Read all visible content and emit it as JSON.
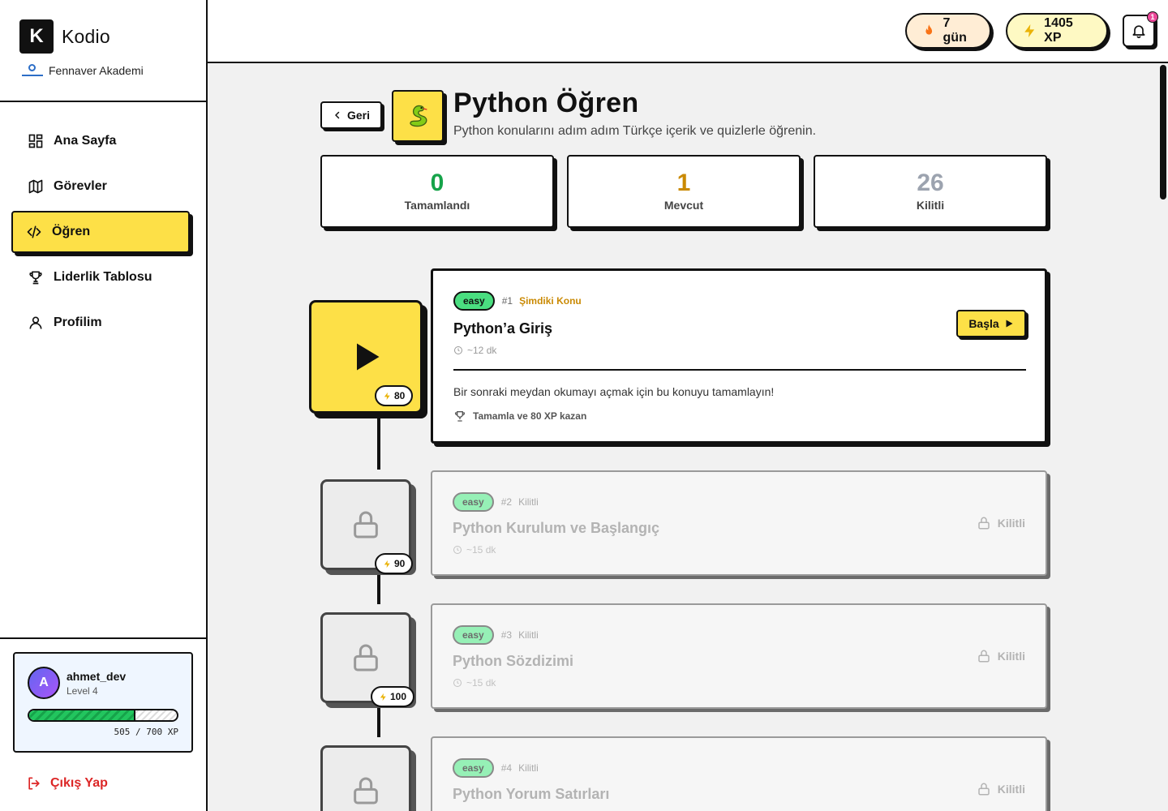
{
  "brand": {
    "logo_letter": "K",
    "name": "Kodio",
    "org": "Fennaver Akademi"
  },
  "nav": [
    {
      "label": "Ana Sayfa",
      "icon": "dashboard-icon",
      "active": false
    },
    {
      "label": "Görevler",
      "icon": "map-icon",
      "active": false
    },
    {
      "label": "Öğren",
      "icon": "code-icon",
      "active": true
    },
    {
      "label": "Liderlik Tablosu",
      "icon": "trophy-icon",
      "active": false
    },
    {
      "label": "Profilim",
      "icon": "user-icon",
      "active": false
    }
  ],
  "user": {
    "avatar_letter": "A",
    "name": "ahmet_dev",
    "level": "Level 4",
    "xp_current": 505,
    "xp_max": 700,
    "xp_text": "505 / 700 XP"
  },
  "logout_label": "Çıkış Yap",
  "topbar": {
    "streak": "7 gün",
    "xp": "1405 XP",
    "notification_count": "1"
  },
  "course": {
    "back_label": "Geri",
    "title": "Python Öğren",
    "subtitle": "Python konularını adım adım Türkçe içerik ve quizlerle öğrenin."
  },
  "stats": [
    {
      "value": "0",
      "label": "Tamamlandı"
    },
    {
      "value": "1",
      "label": "Mevcut"
    },
    {
      "value": "26",
      "label": "Kilitli"
    }
  ],
  "topics": [
    {
      "difficulty": "easy",
      "number": "#1",
      "status": "Şimdiki Konu",
      "title": "Python’a Giriş",
      "time": "~12 dk",
      "xp": "80",
      "start_label": "Başla",
      "description": "Bir sonraki meydan okumayı açmak için bu konuyu tamamlayın!",
      "reward": "Tamamla ve 80 XP kazan"
    },
    {
      "difficulty": "easy",
      "number": "#2",
      "status": "Kilitli",
      "title": "Python Kurulum ve Başlangıç",
      "time": "~15 dk",
      "xp": "90",
      "lock_label": "Kilitli"
    },
    {
      "difficulty": "easy",
      "number": "#3",
      "status": "Kilitli",
      "title": "Python Sözdizimi",
      "time": "~15 dk",
      "xp": "100",
      "lock_label": "Kilitli"
    },
    {
      "difficulty": "easy",
      "number": "#4",
      "status": "Kilitli",
      "title": "Python Yorum Satırları",
      "lock_label": "Kilitli"
    }
  ],
  "colors": {
    "accent_yellow": "#fde047",
    "success_green": "#16a34a",
    "current_gold": "#ca8a04",
    "danger_red": "#dc2626"
  }
}
